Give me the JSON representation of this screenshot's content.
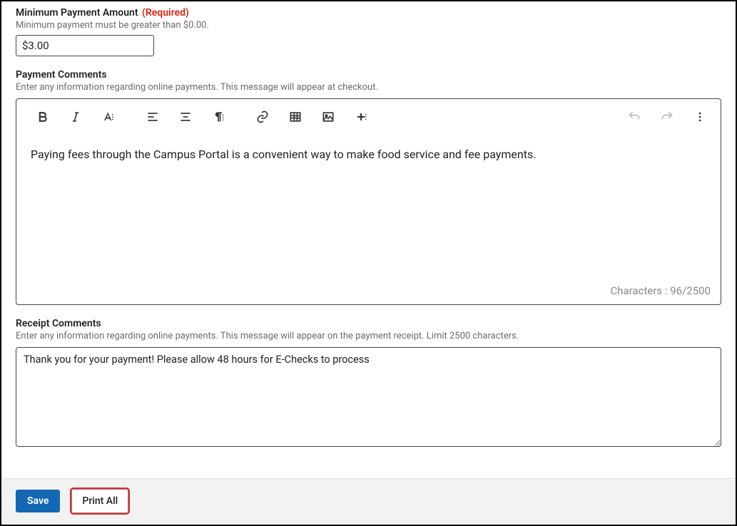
{
  "min_payment": {
    "label": "Minimum Payment Amount",
    "required_tag": "(Required)",
    "helper": "Minimum payment must be greater than $0.00.",
    "value": "$3.00"
  },
  "payment_comments": {
    "label": "Payment Comments",
    "helper": "Enter any information regarding online payments. This message will appear at checkout.",
    "content": "Paying fees through the Campus Portal is a convenient way to make food service and fee payments.",
    "char_count_label": "Characters :",
    "char_count_value": "96/2500"
  },
  "receipt_comments": {
    "label": "Receipt Comments",
    "helper": "Enter any information regarding online payments. This message will appear on the payment receipt. Limit 2500 characters.",
    "value": "Thank you for your payment! Please allow 48 hours for E-Checks to process"
  },
  "footer": {
    "save_label": "Save",
    "print_all_label": "Print All"
  }
}
